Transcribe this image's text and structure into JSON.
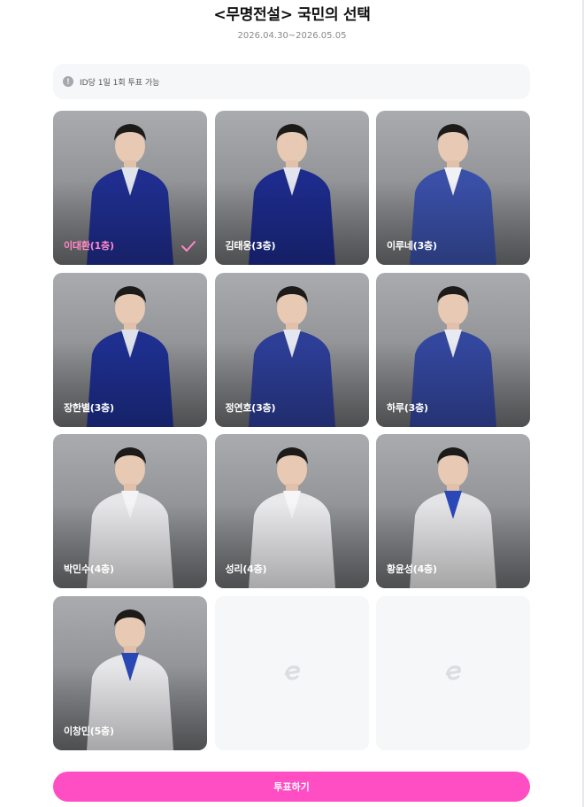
{
  "header": {
    "title": "<무명전설> 국민의 선택",
    "period": "2026.04.30~2026.05.05"
  },
  "notice": {
    "icon": "info-icon",
    "text": "ID당 1일 1회 투표 가능"
  },
  "candidates": [
    {
      "name": "이대환(1층)",
      "selected": true,
      "suit": "#1f2e8f",
      "shirt": "#dfe3ec"
    },
    {
      "name": "김태웅(3층)",
      "selected": false,
      "suit": "#1d2b8c",
      "shirt": "#e2e5ee"
    },
    {
      "name": "이루네(3층)",
      "selected": false,
      "suit": "#3a50a8",
      "shirt": "#f0f1f4"
    },
    {
      "name": "장한별(3층)",
      "selected": false,
      "suit": "#1e2f90",
      "shirt": "#dde1ea"
    },
    {
      "name": "정연호(3층)",
      "selected": false,
      "suit": "#2d3e97",
      "shirt": "#e4e7ef"
    },
    {
      "name": "하루(3층)",
      "selected": false,
      "suit": "#34479f",
      "shirt": "#e8eaf1"
    },
    {
      "name": "박민수(4층)",
      "selected": false,
      "suit": "#e6e6e8",
      "shirt": "#f4f4f6"
    },
    {
      "name": "성리(4층)",
      "selected": false,
      "suit": "#e9e9eb",
      "shirt": "#f6f6f8"
    },
    {
      "name": "황윤성(4층)",
      "selected": false,
      "suit": "#e4e4e6",
      "shirt": "#2b48b8"
    },
    {
      "name": "이창민(5층)",
      "selected": false,
      "suit": "#e7e7e9",
      "shirt": "#2a47b6"
    }
  ],
  "empty_slots": 2,
  "vote_button": {
    "label": "투표하기"
  },
  "colors": {
    "accent": "#ff4dc4",
    "selected_name": "#ff88c8"
  }
}
